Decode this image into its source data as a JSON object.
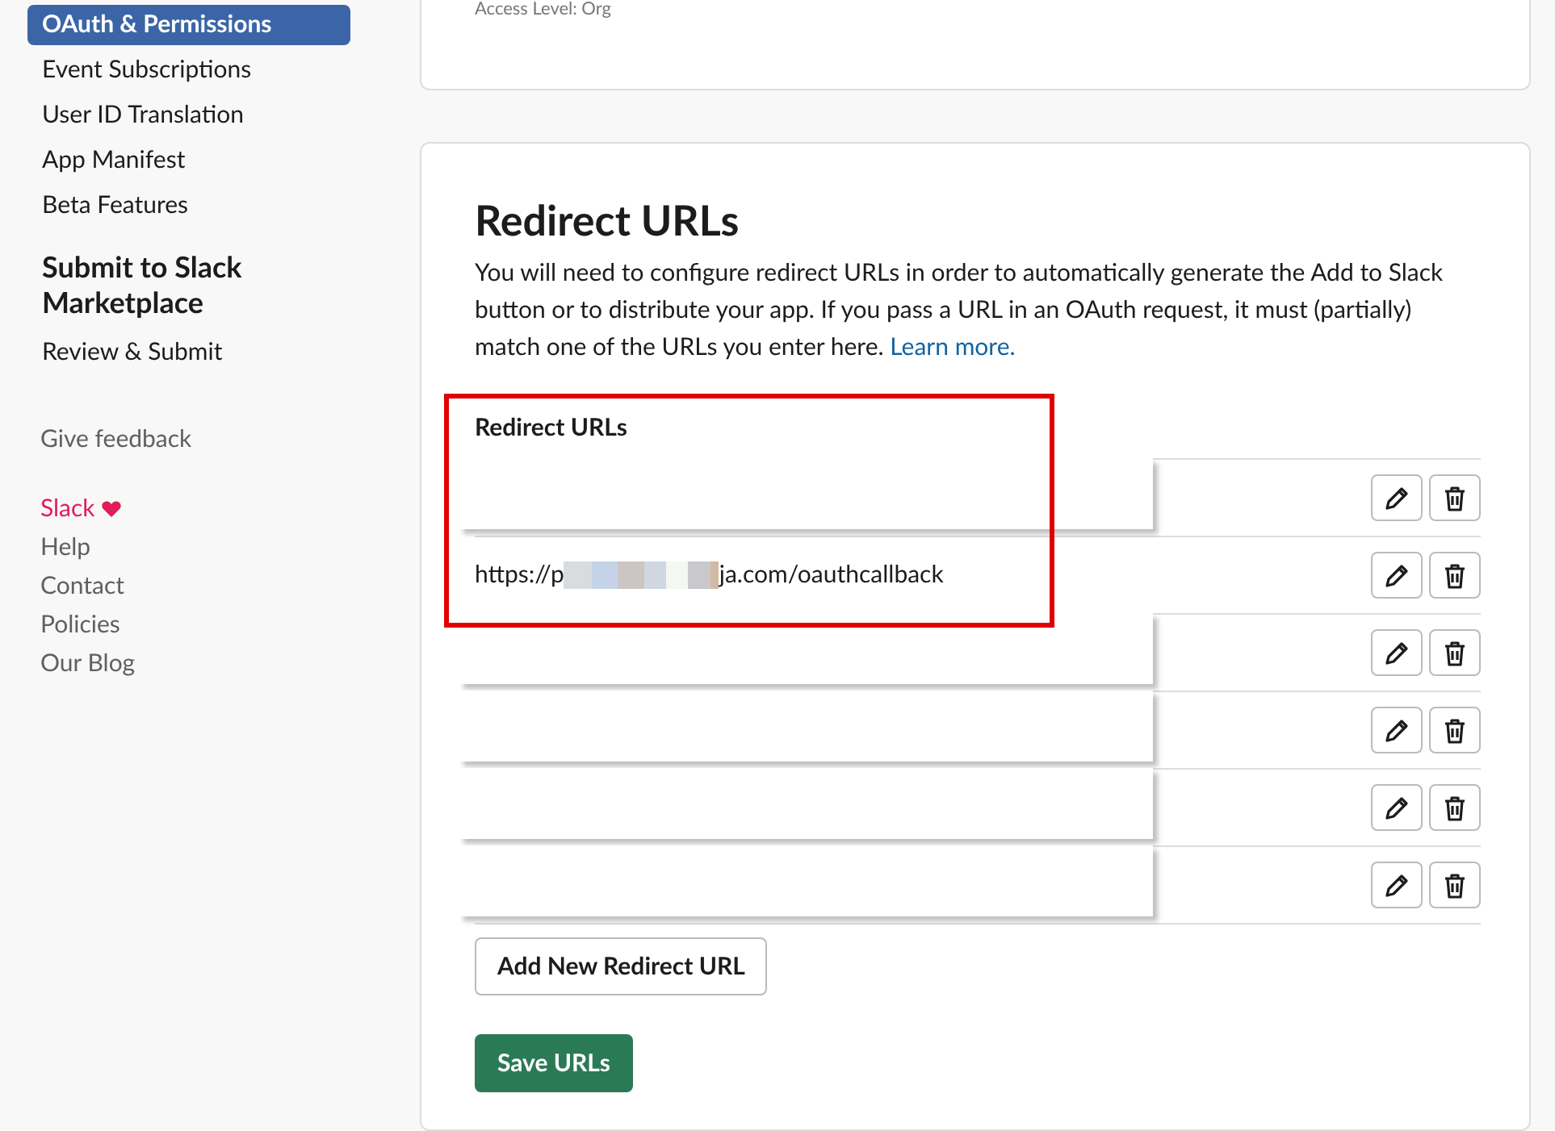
{
  "sidebar": {
    "items": [
      {
        "label": "OAuth & Permissions",
        "selected": true
      },
      {
        "label": "Event Subscriptions",
        "selected": false
      },
      {
        "label": "User ID Translation",
        "selected": false
      },
      {
        "label": "App Manifest",
        "selected": false
      },
      {
        "label": "Beta Features",
        "selected": false
      }
    ],
    "section_title": "Submit to Slack Marketplace",
    "section_items": [
      {
        "label": "Review & Submit",
        "selected": false
      }
    ],
    "feedback": "Give feedback",
    "footer_links": [
      {
        "label": "Slack",
        "kind": "brand"
      },
      {
        "label": "Help",
        "kind": "plain"
      },
      {
        "label": "Contact",
        "kind": "plain"
      },
      {
        "label": "Policies",
        "kind": "plain"
      },
      {
        "label": "Our Blog",
        "kind": "plain"
      }
    ]
  },
  "top_card": {
    "text": "Access Level: Org"
  },
  "redirect_card": {
    "title": "Redirect URLs",
    "description": "You will need to configure redirect URLs in order to automatically generate the Add to Slack button or to distribute your app. If you pass a URL in an OAuth request, it must (partially) match one of the URLs you enter here.",
    "link": "Learn more.",
    "list_label": "Redirect URLs",
    "rows": [
      {
        "covered": true
      },
      {
        "covered": false,
        "url_start": "https://p",
        "url_end": "ja.com/oauthcallback"
      },
      {
        "covered": true
      },
      {
        "covered": true
      },
      {
        "covered": true
      },
      {
        "covered": true
      }
    ],
    "add_button": "Add New Redirect URL",
    "save_button": "Save URLs"
  }
}
